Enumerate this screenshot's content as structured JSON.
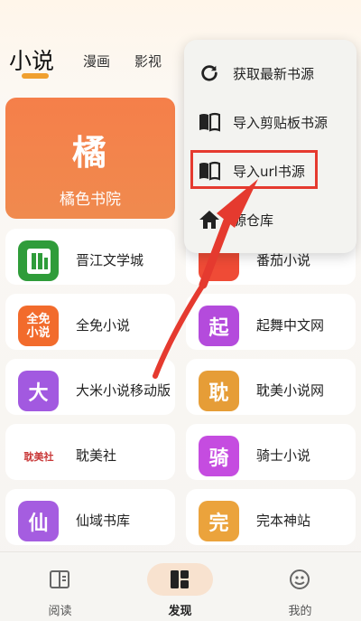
{
  "top_tabs": {
    "main": "小说",
    "comic": "漫画",
    "video": "影视"
  },
  "featured": {
    "logo_text": "橘",
    "name": "橘色书院",
    "color": "#f57f4a"
  },
  "sites": [
    {
      "name": "晋江文学城",
      "icon_text": "",
      "color": "#2f9c3a"
    },
    {
      "name": "番茄小说",
      "icon_text": "",
      "color": "#ef4b36"
    },
    {
      "name": "全免小说",
      "icon_text": "全免\n小说",
      "color": "#f26b2c"
    },
    {
      "name": "起舞中文网",
      "icon_text": "起",
      "color": "#b44bdc"
    },
    {
      "name": "大米小说移动版",
      "icon_text": "大",
      "color": "#a259e0"
    },
    {
      "name": "耽美小说网",
      "icon_text": "耽",
      "color": "#e69d37"
    },
    {
      "name": "耽美社",
      "icon_text": "耽美社",
      "color": "#c93838"
    },
    {
      "name": "骑士小说",
      "icon_text": "骑",
      "color": "#c54ce0"
    },
    {
      "name": "仙域书库",
      "icon_text": "仙",
      "color": "#a55de0"
    },
    {
      "name": "完本神站",
      "icon_text": "完",
      "color": "#eba33c"
    }
  ],
  "menu": {
    "items": [
      {
        "label": "获取最新书源",
        "icon": "refresh-icon"
      },
      {
        "label": "导入剪贴板书源",
        "icon": "book-icon"
      },
      {
        "label": "导入url书源",
        "icon": "book-icon"
      },
      {
        "label": "源仓库",
        "icon": "home-icon"
      }
    ]
  },
  "annotation": {
    "highlight_color": "#e53a2f",
    "arrow_color": "#e53a2f"
  },
  "bottom_nav": {
    "items": [
      {
        "label": "阅读",
        "icon": "book-open-icon"
      },
      {
        "label": "发现",
        "icon": "discover-grid-icon"
      },
      {
        "label": "我的",
        "icon": "profile-icon"
      }
    ],
    "accent": "#f8e2cf"
  }
}
